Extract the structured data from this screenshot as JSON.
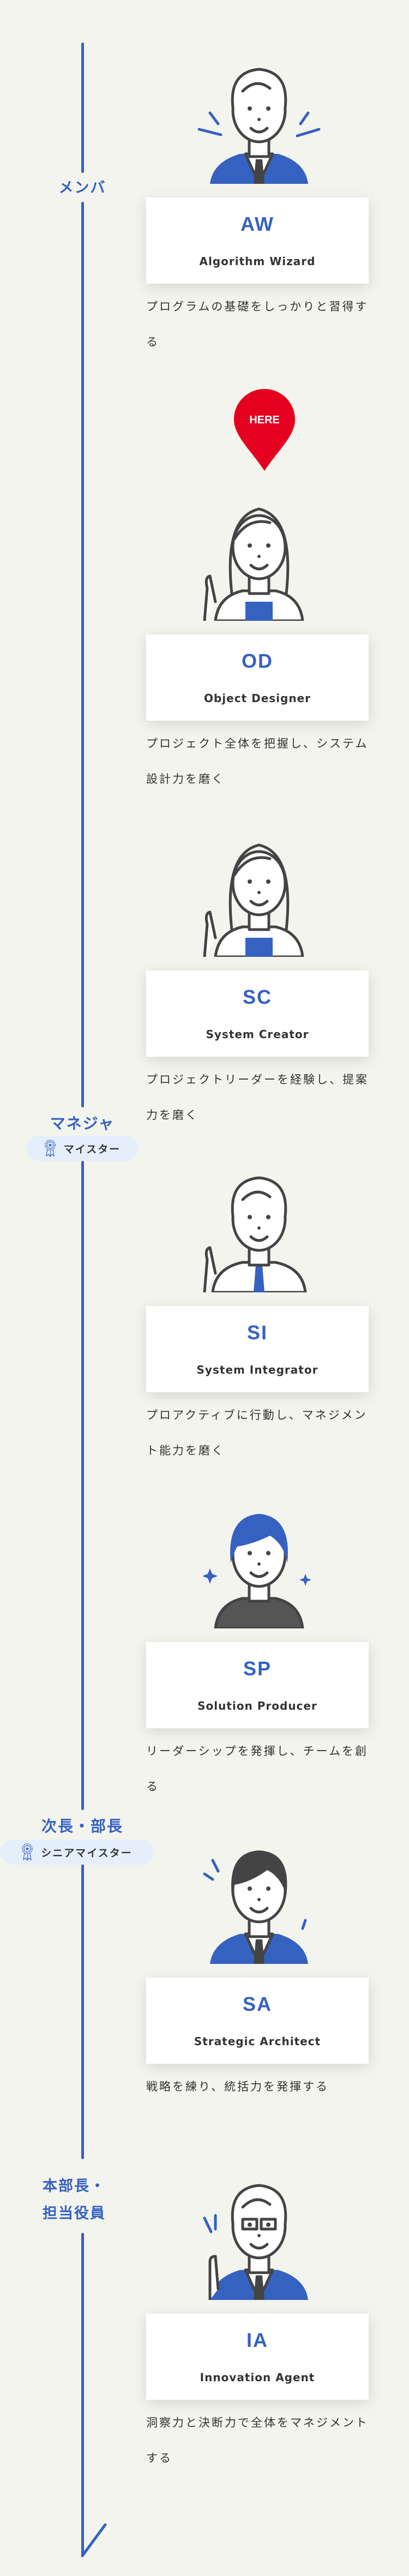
{
  "colors": {
    "accent": "#3561c1",
    "here": "#e60020",
    "background": "#f3f4ee",
    "badge_bg": "#e5effb"
  },
  "here_marker": {
    "label": "HERE",
    "icon": "map-pin-icon"
  },
  "levels": [
    {
      "label": "メンバ"
    },
    {
      "label": "マネジャ",
      "badge": {
        "icon": "award-ribbon-icon",
        "label": "マイスター"
      }
    },
    {
      "label": "次長・部長",
      "badge": {
        "icon": "award-ribbon-icon",
        "label": "シニアマイスター"
      }
    },
    {
      "label_lines": [
        "本部長・",
        "担当役員"
      ]
    }
  ],
  "roles": [
    {
      "code": "AW",
      "title": "Algorithm Wizard",
      "description": "プログラムの基礎をしっかりと習得する"
    },
    {
      "code": "OD",
      "title": "Object Designer",
      "description": "プロジェクト全体を把握し、システム設計力を磨く"
    },
    {
      "code": "SC",
      "title": "System Creator",
      "description": "プロジェクトリーダーを経験し、提案力を磨く"
    },
    {
      "code": "SI",
      "title": "System Integrator",
      "description": "プロアクティブに行動し、マネジメント能力を磨く"
    },
    {
      "code": "SP",
      "title": "Solution Producer",
      "description": "リーダーシップを発揮し、チームを創る"
    },
    {
      "code": "SA",
      "title": "Strategic Architect",
      "description": "戦略を練り、統括力を発揮する"
    },
    {
      "code": "IA",
      "title": "Innovation Agent",
      "description": "洞察力と決断力で全体をマネジメントする"
    }
  ]
}
